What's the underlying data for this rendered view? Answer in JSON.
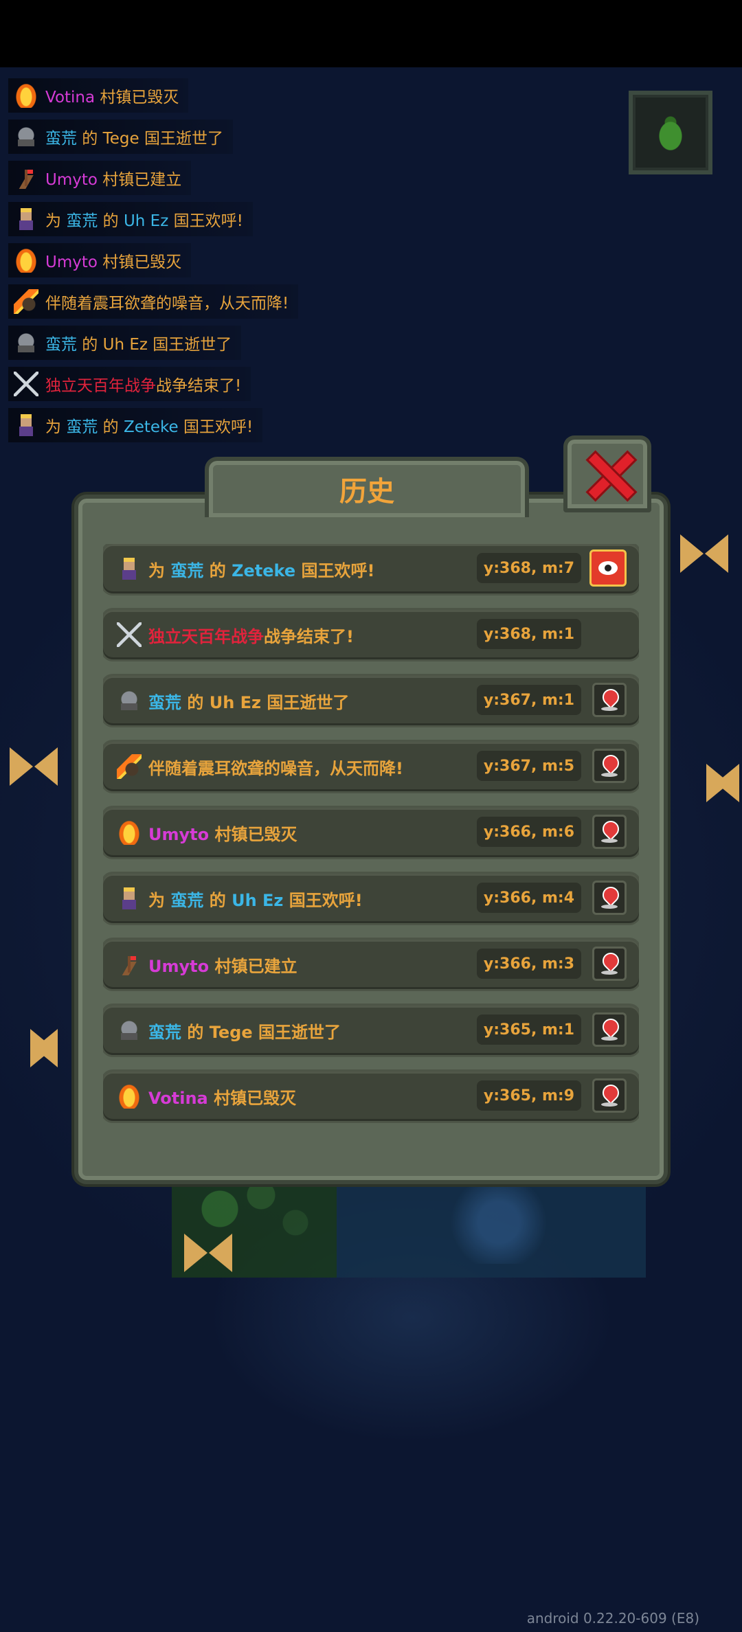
{
  "log": [
    {
      "icon": "fire-icon",
      "parts": [
        {
          "t": "Votina",
          "c": "magenta"
        },
        {
          "t": " 村镇已毁灭",
          "c": "sand"
        }
      ]
    },
    {
      "icon": "grave-icon",
      "parts": [
        {
          "t": "蛮荒",
          "c": "blue"
        },
        {
          "t": " 的 Tege 国王逝世了",
          "c": "sand"
        }
      ]
    },
    {
      "icon": "village-icon",
      "parts": [
        {
          "t": "Umyto",
          "c": "magenta"
        },
        {
          "t": " 村镇已建立",
          "c": "sand"
        }
      ]
    },
    {
      "icon": "king-icon",
      "parts": [
        {
          "t": "为 ",
          "c": "sand"
        },
        {
          "t": "蛮荒",
          "c": "blue"
        },
        {
          "t": " 的 ",
          "c": "sand"
        },
        {
          "t": "Uh Ez",
          "c": "blue"
        },
        {
          "t": " 国王欢呼!",
          "c": "sand"
        }
      ]
    },
    {
      "icon": "fire-icon",
      "parts": [
        {
          "t": "Umyto",
          "c": "magenta"
        },
        {
          "t": " 村镇已毁灭",
          "c": "sand"
        }
      ]
    },
    {
      "icon": "meteor-icon",
      "parts": [
        {
          "t": "伴随着震耳欲聋的噪音，从天而降!",
          "c": "sand"
        }
      ]
    },
    {
      "icon": "grave-icon",
      "parts": [
        {
          "t": "蛮荒",
          "c": "blue"
        },
        {
          "t": " 的 Uh Ez 国王逝世了",
          "c": "sand"
        }
      ]
    },
    {
      "icon": "war-icon",
      "parts": [
        {
          "t": "独立天百年战争",
          "c": "red"
        },
        {
          "t": "战争结束了!",
          "c": "sand"
        }
      ]
    },
    {
      "icon": "king-icon",
      "parts": [
        {
          "t": "为 ",
          "c": "sand"
        },
        {
          "t": "蛮荒",
          "c": "blue"
        },
        {
          "t": " 的 ",
          "c": "sand"
        },
        {
          "t": "Zeteke",
          "c": "blue"
        },
        {
          "t": " 国王欢呼!",
          "c": "sand"
        }
      ]
    }
  ],
  "window": {
    "title": "历史"
  },
  "history": [
    {
      "icon": "king-icon",
      "parts": [
        {
          "t": "为 ",
          "c": "sand"
        },
        {
          "t": "蛮荒",
          "c": "blue"
        },
        {
          "t": " 的 ",
          "c": "sand"
        },
        {
          "t": "Zeteke",
          "c": "blue"
        },
        {
          "t": " 国王欢呼!",
          "c": "sand"
        }
      ],
      "date": "y:368, m:7",
      "action": "eye"
    },
    {
      "icon": "war-icon",
      "parts": [
        {
          "t": "独立天百年战争",
          "c": "red"
        },
        {
          "t": "战争结束了!",
          "c": "sand"
        }
      ],
      "date": "y:368, m:1",
      "action": "none"
    },
    {
      "icon": "grave-icon",
      "parts": [
        {
          "t": "蛮荒",
          "c": "blue"
        },
        {
          "t": " 的 Uh Ez 国王逝世了",
          "c": "sand"
        }
      ],
      "date": "y:367, m:1",
      "action": "pin"
    },
    {
      "icon": "meteor-icon",
      "parts": [
        {
          "t": "伴随着震耳欲聋的噪音，从天而降!",
          "c": "sand"
        }
      ],
      "date": "y:367, m:5",
      "action": "pin"
    },
    {
      "icon": "fire-icon",
      "parts": [
        {
          "t": "Umyto",
          "c": "magenta"
        },
        {
          "t": " 村镇已毁灭",
          "c": "sand"
        }
      ],
      "date": "y:366, m:6",
      "action": "pin"
    },
    {
      "icon": "king-icon",
      "parts": [
        {
          "t": "为 ",
          "c": "sand"
        },
        {
          "t": "蛮荒",
          "c": "blue"
        },
        {
          "t": " 的 ",
          "c": "sand"
        },
        {
          "t": "Uh Ez",
          "c": "blue"
        },
        {
          "t": " 国王欢呼!",
          "c": "sand"
        }
      ],
      "date": "y:366, m:4",
      "action": "pin"
    },
    {
      "icon": "village-icon",
      "parts": [
        {
          "t": "Umyto",
          "c": "magenta"
        },
        {
          "t": " 村镇已建立",
          "c": "sand"
        }
      ],
      "date": "y:366, m:3",
      "action": "pin"
    },
    {
      "icon": "grave-icon",
      "parts": [
        {
          "t": "蛮荒",
          "c": "blue"
        },
        {
          "t": " 的 Tege 国王逝世了",
          "c": "sand"
        }
      ],
      "date": "y:365, m:1",
      "action": "pin"
    },
    {
      "icon": "fire-icon",
      "parts": [
        {
          "t": "Votina",
          "c": "magenta"
        },
        {
          "t": " 村镇已毁灭",
          "c": "sand"
        }
      ],
      "date": "y:365, m:9",
      "action": "pin"
    }
  ],
  "version": "android 0.22.20-609 (E8)",
  "colors": {
    "magenta": "#d63bd6",
    "blue": "#3bb6e6",
    "red": "#e0233c",
    "sand": "#e8a43c",
    "title": "#f2a43a"
  }
}
